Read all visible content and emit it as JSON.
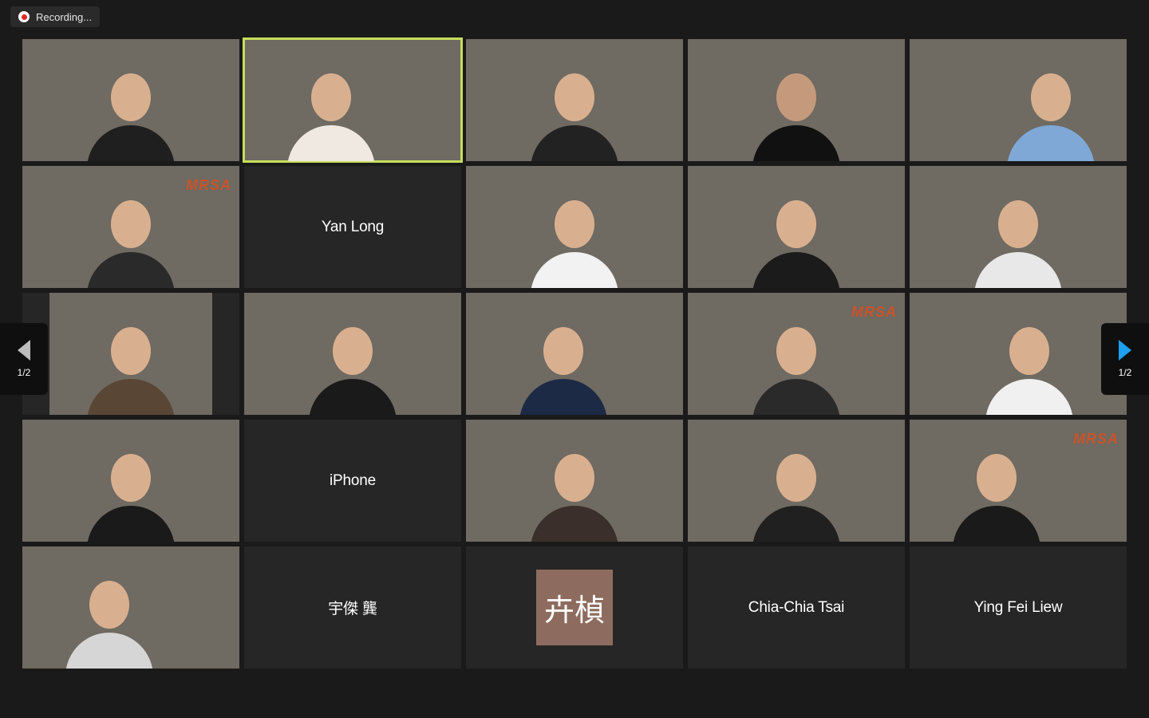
{
  "recording": {
    "label": "Recording...",
    "dot_color": "#e02828"
  },
  "pagination": {
    "left_label": "1/2",
    "right_label": "1/2"
  },
  "tiles": [
    {
      "kind": "video",
      "name": "",
      "active": false
    },
    {
      "kind": "video",
      "name": "",
      "active": true
    },
    {
      "kind": "video",
      "name": "",
      "active": false
    },
    {
      "kind": "video",
      "name": "",
      "active": false
    },
    {
      "kind": "video",
      "name": "",
      "active": false
    },
    {
      "kind": "video",
      "name": "",
      "active": false,
      "logo": "MRSA"
    },
    {
      "kind": "name",
      "name": "Yan Long"
    },
    {
      "kind": "video",
      "name": "",
      "active": false
    },
    {
      "kind": "video",
      "name": "",
      "active": false
    },
    {
      "kind": "video",
      "name": "",
      "active": false
    },
    {
      "kind": "video",
      "name": "",
      "active": false
    },
    {
      "kind": "video",
      "name": "",
      "active": false
    },
    {
      "kind": "video",
      "name": "",
      "active": false
    },
    {
      "kind": "video",
      "name": "",
      "active": false,
      "logo": "MRSA"
    },
    {
      "kind": "video",
      "name": "",
      "active": false
    },
    {
      "kind": "video",
      "name": "",
      "active": false
    },
    {
      "kind": "name",
      "name": "iPhone"
    },
    {
      "kind": "video",
      "name": "",
      "active": false
    },
    {
      "kind": "video",
      "name": "",
      "active": false
    },
    {
      "kind": "video",
      "name": "",
      "active": false,
      "logo": "MRSA"
    },
    {
      "kind": "video",
      "name": "",
      "active": false
    },
    {
      "kind": "name",
      "name": "宇傑 龔"
    },
    {
      "kind": "avatar",
      "avatar_text": "卉楨"
    },
    {
      "kind": "name",
      "name": "Chia-Chia Tsai"
    },
    {
      "kind": "name",
      "name": "Ying Fei Liew"
    }
  ],
  "colors": {
    "background": "#1a1a1a",
    "tile": "#262626",
    "active_border": "#c6df5b",
    "avatar_bg": "#8d6c5f",
    "next_arrow": "#1e9ef0"
  }
}
